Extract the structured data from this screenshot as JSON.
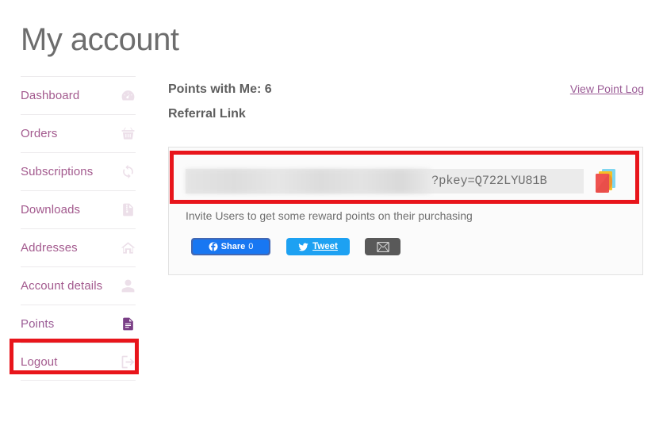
{
  "page": {
    "title": "My account"
  },
  "sidebar": {
    "items": [
      {
        "label": "Dashboard",
        "icon": "dashboard-icon",
        "active": false
      },
      {
        "label": "Orders",
        "icon": "basket-icon",
        "active": false
      },
      {
        "label": "Subscriptions",
        "icon": "refresh-icon",
        "active": false
      },
      {
        "label": "Downloads",
        "icon": "download-file-icon",
        "active": false
      },
      {
        "label": "Addresses",
        "icon": "home-icon",
        "active": false
      },
      {
        "label": "Account details",
        "icon": "user-icon",
        "active": false
      },
      {
        "label": "Points",
        "icon": "document-icon",
        "active": true
      },
      {
        "label": "Logout",
        "icon": "sign-out-icon",
        "active": false
      }
    ]
  },
  "main": {
    "points_heading": "Points with Me: 6",
    "referral_heading": "Referral Link",
    "view_point_log": "View Point Log",
    "referral": {
      "url_redacted": "",
      "key_suffix": "?pkey=Q722LYU81B",
      "copy_icon": "copy-stack-icon",
      "hint": "Invite Users to get some reward points on their purchasing"
    },
    "share": {
      "facebook_label": "Share",
      "facebook_count": "0",
      "facebook_icon": "facebook-icon",
      "twitter_label": "Tweet",
      "twitter_icon": "twitter-bird-icon",
      "email_icon": "envelope-icon"
    }
  },
  "annotations": {
    "referral_box_color": "#e8151b",
    "points_box_color": "#e8151b"
  },
  "colors": {
    "nav_link": "#a35a8e",
    "heading": "#5e5e5e",
    "facebook": "#1877f2",
    "twitter": "#1da1f2",
    "email_button": "#595959"
  }
}
